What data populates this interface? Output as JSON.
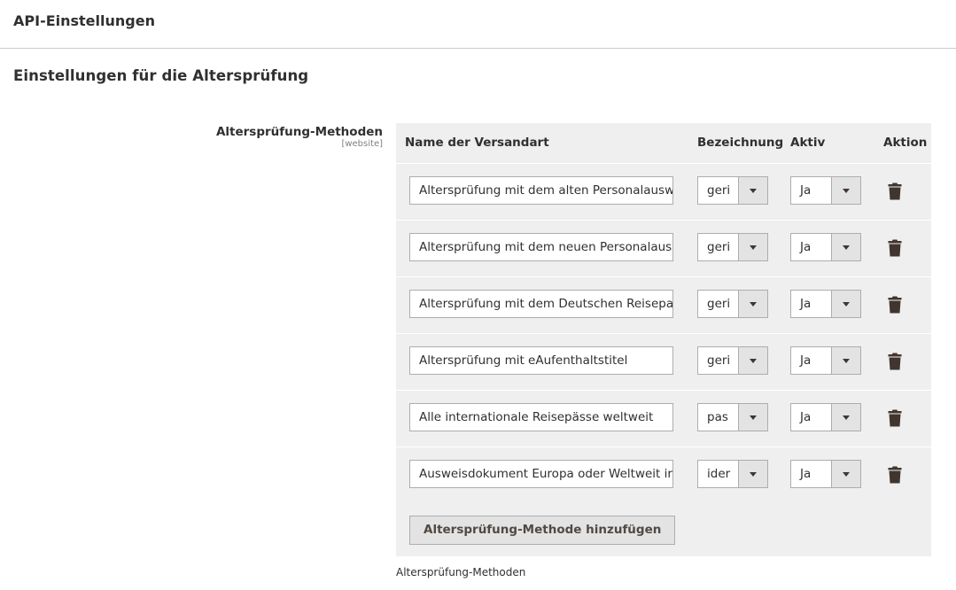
{
  "page": {
    "section_title": "API-Einstellungen",
    "group_title": "Einstellungen für die Altersprüfung"
  },
  "field": {
    "label": "Altersprüfung-Methoden",
    "scope": "[website]",
    "comment": "Altersprüfung-Methoden"
  },
  "grid": {
    "headers": {
      "name": "Name der Versandart",
      "label": "Bezeichnung",
      "active": "Aktiv",
      "action": "Aktion"
    },
    "rows": [
      {
        "name": "Altersprüfung mit dem alten Personalausw",
        "label": "geri",
        "active": "Ja"
      },
      {
        "name": "Altersprüfung mit dem neuen Personalaus",
        "label": "geri",
        "active": "Ja"
      },
      {
        "name": "Altersprüfung mit dem Deutschen Reisepa",
        "label": "geri",
        "active": "Ja"
      },
      {
        "name": "Altersprüfung mit eAufenthaltstitel",
        "label": "geri",
        "active": "Ja"
      },
      {
        "name": "Alle internationale Reisepässe weltweit",
        "label": "pas",
        "active": "Ja"
      },
      {
        "name": "Ausweisdokument Europa oder Weltweit ir",
        "label": "ider",
        "active": "Ja"
      }
    ],
    "add_button_label": "Altersprüfung-Methode hinzufügen"
  },
  "icons": {
    "delete": "trash-icon",
    "dropdown": "chevron-down-icon"
  },
  "colors": {
    "text": "#303030",
    "grid_bg": "#efefef",
    "button_bg": "#e3e3e3",
    "border": "#adadad",
    "icon": "#41362f"
  }
}
